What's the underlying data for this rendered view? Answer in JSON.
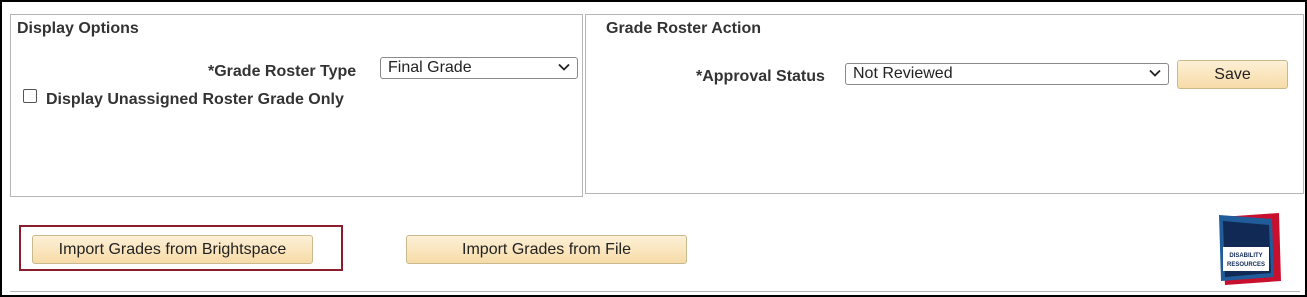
{
  "display_options": {
    "title": "Display Options",
    "grade_roster_type_label": "*Grade Roster Type",
    "grade_roster_type_value": "Final Grade",
    "unassigned_checkbox_label": "Display Unassigned Roster Grade Only",
    "unassigned_checked": false
  },
  "grade_roster_action": {
    "title": "Grade Roster Action",
    "approval_status_label": "*Approval Status",
    "approval_status_value": "Not Reviewed",
    "save_label": "Save"
  },
  "import": {
    "brightspace_label": "Import Grades from Brightspace",
    "file_label": "Import Grades from File"
  },
  "logo": {
    "line1": "DISABILITY",
    "line2": "RESOURCES",
    "colors": {
      "red": "#c8102e",
      "blue": "#1f5c99",
      "navy": "#102a55"
    }
  },
  "colors": {
    "button_top": "#fdf0d6",
    "button_bottom": "#f7dba8",
    "highlight_border": "#8b1d2c"
  },
  "icons": {
    "dropdown": "chevron-down-icon",
    "checkbox": "checkbox-icon"
  }
}
